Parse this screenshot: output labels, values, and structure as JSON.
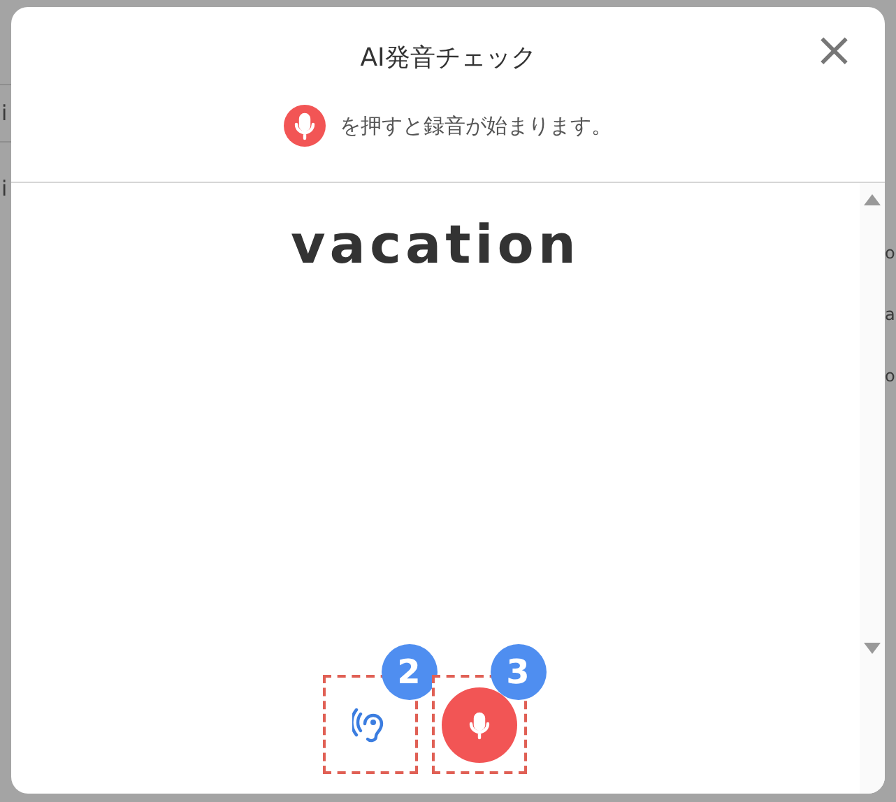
{
  "background": {
    "left_fragments": [
      "i",
      "i"
    ],
    "right_fragments": [
      "o",
      "a",
      "o"
    ]
  },
  "dialog": {
    "title": "AI発音チェック",
    "close": "×",
    "hint": "を押すと録音が始まります。",
    "word": "vacation",
    "controls": [
      {
        "kind": "listen",
        "badge": "2"
      },
      {
        "kind": "record",
        "badge": "3"
      }
    ]
  }
}
